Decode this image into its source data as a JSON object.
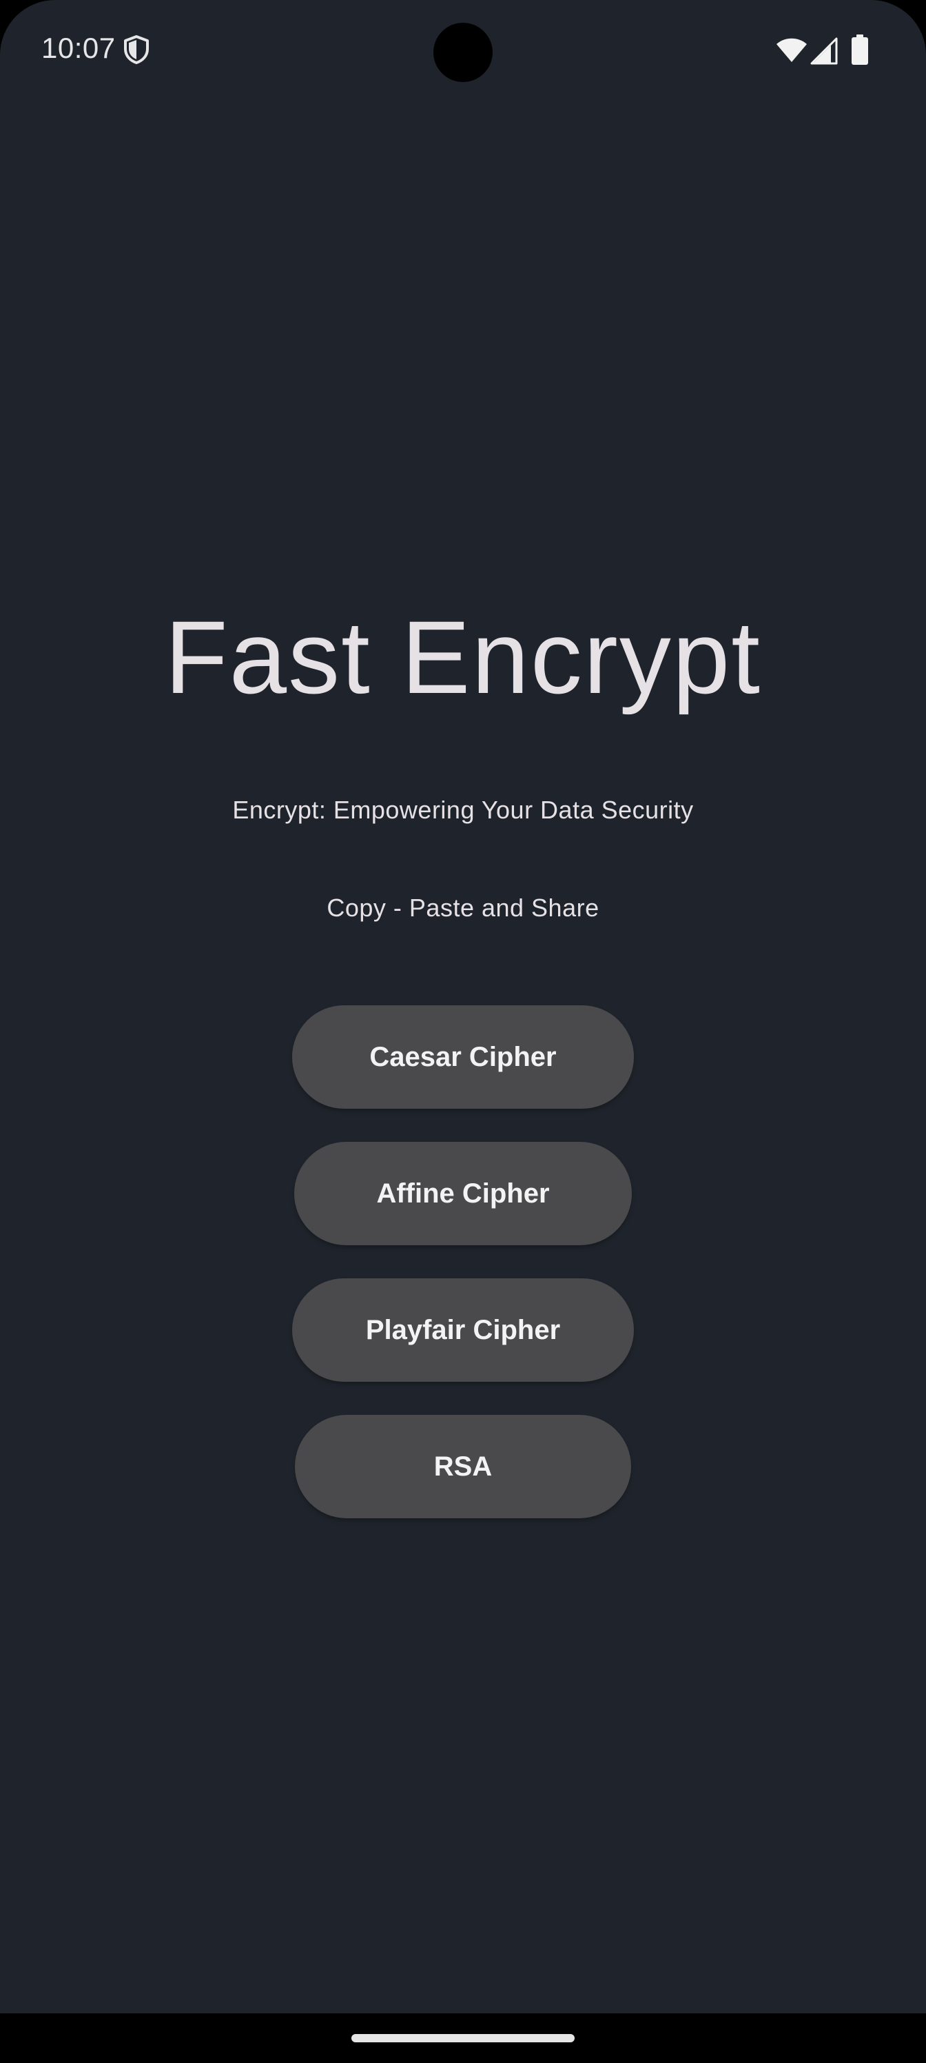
{
  "status_bar": {
    "time": "10:07",
    "icons": [
      "shield-icon",
      "wifi-icon",
      "signal-icon",
      "battery-icon"
    ]
  },
  "main": {
    "title": "Fast Encrypt",
    "tagline": "Encrypt: Empowering Your Data Security",
    "subtagline": "Copy - Paste and Share",
    "buttons": [
      {
        "label": "Caesar Cipher"
      },
      {
        "label": "Affine Cipher"
      },
      {
        "label": "Playfair Cipher"
      },
      {
        "label": "RSA"
      }
    ]
  },
  "colors": {
    "background": "#1f242c",
    "button": "#4a4a4c",
    "text": "#e6e1e5"
  }
}
